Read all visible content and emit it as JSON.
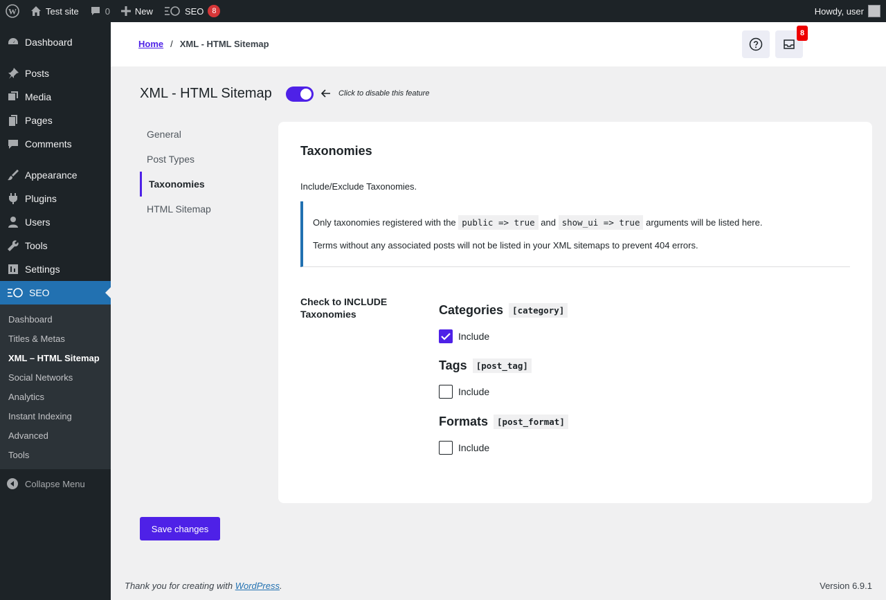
{
  "adminbar": {
    "site_name": "Test site",
    "comments_count": "0",
    "new_label": "New",
    "seo_label": "SEO",
    "seo_badge": "8",
    "howdy": "Howdy, user"
  },
  "sidebar": {
    "items": [
      {
        "label": "Dashboard",
        "icon": "dashboard-icon"
      },
      {
        "label": "Posts",
        "icon": "pin-icon"
      },
      {
        "label": "Media",
        "icon": "media-icon"
      },
      {
        "label": "Pages",
        "icon": "pages-icon"
      },
      {
        "label": "Comments",
        "icon": "comment-icon"
      },
      {
        "label": "Appearance",
        "icon": "brush-icon"
      },
      {
        "label": "Plugins",
        "icon": "plugin-icon"
      },
      {
        "label": "Users",
        "icon": "user-icon"
      },
      {
        "label": "Tools",
        "icon": "wrench-icon"
      },
      {
        "label": "Settings",
        "icon": "settings-icon"
      },
      {
        "label": "SEO",
        "icon": "seo-icon"
      }
    ],
    "submenu": [
      "Dashboard",
      "Titles & Metas",
      "XML – HTML Sitemap",
      "Social Networks",
      "Analytics",
      "Instant Indexing",
      "Advanced",
      "Tools"
    ],
    "collapse": "Collapse Menu"
  },
  "header": {
    "home": "Home",
    "sep": "/",
    "current": "XML - HTML Sitemap",
    "notif_badge": "8"
  },
  "page": {
    "title": "XML - HTML Sitemap",
    "toggle_hint": "Click to disable this feature"
  },
  "subnav": [
    "General",
    "Post Types",
    "Taxonomies",
    "HTML Sitemap"
  ],
  "card": {
    "title": "Taxonomies",
    "desc": "Include/Exclude Taxonomies.",
    "notice1_a": "Only taxonomies registered with the",
    "notice1_code1": "public => true",
    "notice1_and": "and",
    "notice1_code2": "show_ui => true",
    "notice1_b": "arguments will be listed here.",
    "notice2": "Terms without any associated posts will not be listed in your XML sitemaps to prevent 404 errors.",
    "include_label": "Check to INCLUDE Taxonomies",
    "taxonomies": [
      {
        "name": "Categories",
        "slug": "[category]",
        "label": "Include",
        "checked": true
      },
      {
        "name": "Tags",
        "slug": "[post_tag]",
        "label": "Include",
        "checked": false
      },
      {
        "name": "Formats",
        "slug": "[post_format]",
        "label": "Include",
        "checked": false
      }
    ]
  },
  "save_label": "Save changes",
  "footer": {
    "thanks": "Thank you for creating with",
    "wp": "WordPress",
    "dot": ".",
    "version": "Version 6.9.1"
  },
  "colors": {
    "accent": "#4e21e7",
    "admin_bg": "#1d2327",
    "wp_blue": "#2271b1"
  }
}
